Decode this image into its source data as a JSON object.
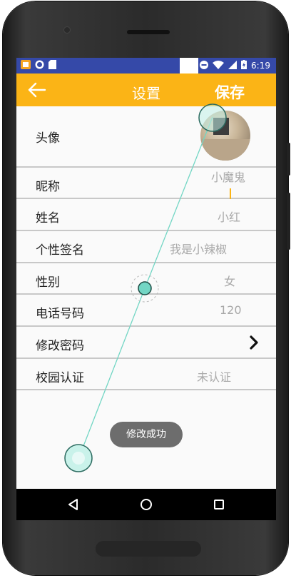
{
  "status_bar": {
    "time": "6:19",
    "left_icons": [
      "app-notification-icon",
      "circle-notification-icon",
      "sd-card-icon"
    ],
    "right_icons": [
      "do-not-disturb-icon",
      "wifi-icon",
      "signal-icon",
      "battery-charging-icon"
    ]
  },
  "app_bar": {
    "back_icon": "arrow-left-icon",
    "title": "设置",
    "save_label": "保存"
  },
  "settings": {
    "avatar_label": "头像",
    "rows": [
      {
        "label": "昵称",
        "value": "小魔鬼"
      },
      {
        "label": "姓名",
        "value": "小红"
      },
      {
        "label": "个性签名",
        "value": "我是小辣椒"
      },
      {
        "label": "性别",
        "value": "女"
      },
      {
        "label": "电话号码",
        "value": "120"
      },
      {
        "label": "修改密码",
        "value": ""
      },
      {
        "label": "校园认证",
        "value": "未认证"
      }
    ]
  },
  "toast": {
    "text": "修改成功"
  },
  "nav_bar": {
    "icons": [
      "back-triangle-icon",
      "home-circle-icon",
      "recents-square-icon"
    ]
  },
  "colors": {
    "status_bar": "#3549a8",
    "app_bar": "#fbb416",
    "touch_indicator": "#72d6c4"
  }
}
